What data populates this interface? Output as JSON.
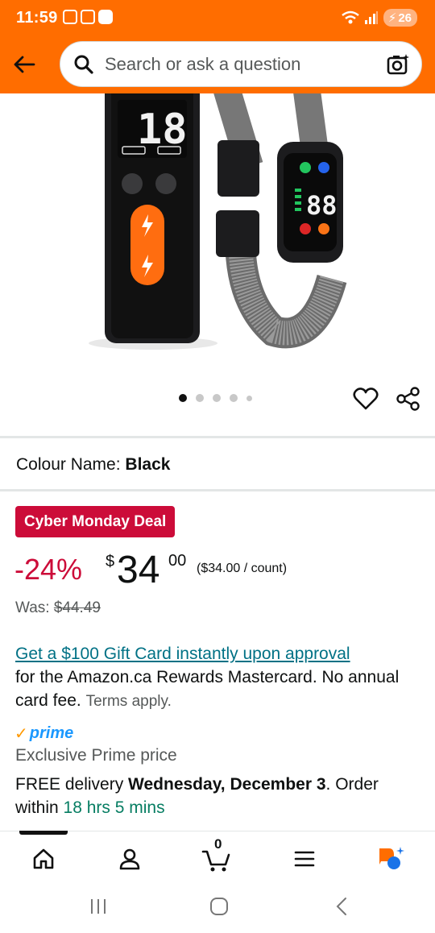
{
  "status_bar": {
    "time": "11:59",
    "battery": "26"
  },
  "header": {
    "back_icon": "arrow-left-icon",
    "search_placeholder": "Search or ask a question",
    "camera_icon": "camera-search-icon"
  },
  "product": {
    "image_count": 5,
    "active_image": 1,
    "colour_label": "Colour Name:",
    "colour_value": "Black"
  },
  "deal": {
    "badge": "Cyber Monday Deal",
    "discount": "-24%",
    "currency_symbol": "$",
    "price_whole": "34",
    "price_fraction": "00",
    "unit_price": "($34.00 / count)",
    "was_label": "Was:",
    "was_price": "$44.49"
  },
  "promo": {
    "link_text": "Get a $100 Gift Card instantly upon approval",
    "description": "for the Amazon.ca Rewards Mastercard. No annual card fee.",
    "terms": "Terms apply."
  },
  "prime": {
    "logo": "prime",
    "exclusive": "Exclusive Prime price",
    "delivery_prefix": "FREE delivery ",
    "delivery_date": "Wednesday, December 3",
    "delivery_mid": ". Order within ",
    "delivery_countdown": "18 hrs 5 mins"
  },
  "bottom_nav": {
    "items": [
      "home-icon",
      "account-icon",
      "cart-icon",
      "menu-icon",
      "rufus-icon"
    ],
    "cart_count": "0"
  },
  "colors": {
    "brand_orange": "#ff6d00",
    "deal_red": "#cc0c39",
    "link_teal": "#007185",
    "prime_blue": "#1a98ff",
    "green": "#067d62"
  }
}
